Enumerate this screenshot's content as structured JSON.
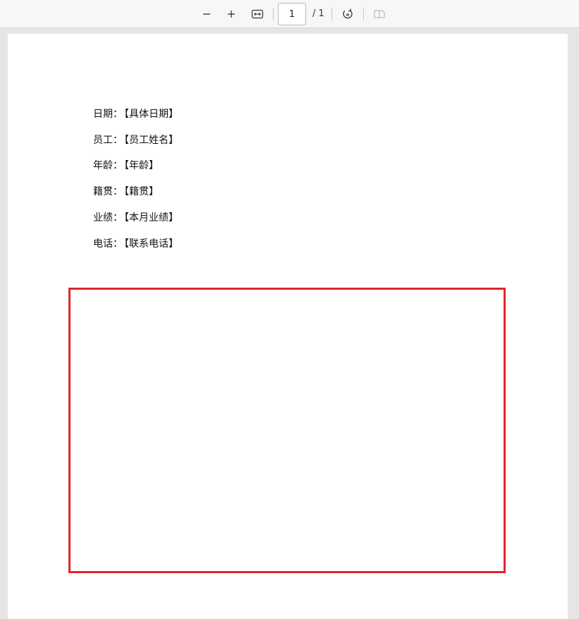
{
  "toolbar": {
    "zoom_out_icon": "minus-icon",
    "zoom_in_icon": "plus-icon",
    "fit_width_icon": "fit-width-icon",
    "current_page": "1",
    "total_pages": "/ 1",
    "rotate_icon": "rotate-icon",
    "page_view_icon": "page-view-icon"
  },
  "document": {
    "fields": [
      {
        "label": "日期：",
        "value": "【具体日期】"
      },
      {
        "label": "员工：",
        "value": "【员工姓名】"
      },
      {
        "label": "年龄：",
        "value": "【年龄】"
      },
      {
        "label": "籍贯：",
        "value": "【籍贯】"
      },
      {
        "label": "业绩：",
        "value": "【本月业绩】"
      },
      {
        "label": "电话：",
        "value": "【联系电话】"
      }
    ],
    "frame_color": "#e0262b"
  }
}
